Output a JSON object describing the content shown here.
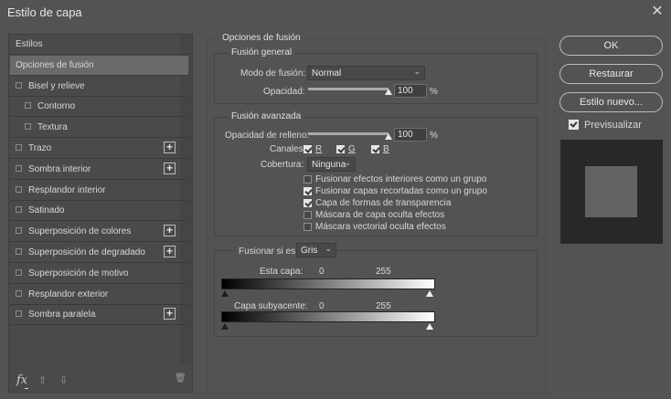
{
  "window": {
    "title": "Estilo de capa",
    "close_glyph": "✕"
  },
  "sidebar": {
    "items": [
      {
        "label": "Estilos",
        "checkbox": false,
        "plus": false,
        "indent": 0,
        "selected": false
      },
      {
        "label": "Opciones de fusión",
        "checkbox": false,
        "plus": false,
        "indent": 0,
        "selected": true
      },
      {
        "label": "Bisel y relieve",
        "checkbox": true,
        "plus": false,
        "indent": 0,
        "selected": false
      },
      {
        "label": "Contorno",
        "checkbox": true,
        "plus": false,
        "indent": 1,
        "selected": false
      },
      {
        "label": "Textura",
        "checkbox": true,
        "plus": false,
        "indent": 1,
        "selected": false
      },
      {
        "label": "Trazo",
        "checkbox": true,
        "plus": true,
        "indent": 0,
        "selected": false
      },
      {
        "label": "Sombra interior",
        "checkbox": true,
        "plus": true,
        "indent": 0,
        "selected": false
      },
      {
        "label": "Resplandor interior",
        "checkbox": true,
        "plus": false,
        "indent": 0,
        "selected": false
      },
      {
        "label": "Satinado",
        "checkbox": true,
        "plus": false,
        "indent": 0,
        "selected": false
      },
      {
        "label": "Superposición de colores",
        "checkbox": true,
        "plus": true,
        "indent": 0,
        "selected": false
      },
      {
        "label": "Superposición de degradado",
        "checkbox": true,
        "plus": true,
        "indent": 0,
        "selected": false
      },
      {
        "label": "Superposición de motivo",
        "checkbox": true,
        "plus": false,
        "indent": 0,
        "selected": false
      },
      {
        "label": "Resplandor exterior",
        "checkbox": true,
        "plus": false,
        "indent": 0,
        "selected": false
      },
      {
        "label": "Sombra paralela",
        "checkbox": true,
        "plus": true,
        "indent": 0,
        "selected": false
      }
    ],
    "bottom": {
      "fx": "fx",
      "up": "⇧",
      "down": "⇩",
      "trash": "🗑"
    }
  },
  "blending": {
    "section_title": "Opciones de fusión",
    "general": {
      "title": "Fusión general",
      "mode_label": "Modo de fusión:",
      "mode_value": "Normal",
      "opacity_label": "Opacidad:",
      "opacity_value": "100",
      "opacity_level": 1.0,
      "percent": "%"
    },
    "advanced": {
      "title": "Fusión avanzada",
      "fill_label": "Opacidad de relleno:",
      "fill_value": "100",
      "fill_level": 1.0,
      "percent": "%",
      "channels_label": "Canales:",
      "channels": [
        {
          "label": "R",
          "checked": true
        },
        {
          "label": "G",
          "checked": true
        },
        {
          "label": "B",
          "checked": true
        }
      ],
      "knockout_label": "Cobertura:",
      "knockout_value": "Ninguna",
      "options": [
        {
          "label": "Fusionar efectos interiores como un grupo",
          "checked": false
        },
        {
          "label": "Fusionar capas recortadas como un grupo",
          "checked": true
        },
        {
          "label": "Capa de formas de transparencia",
          "checked": true
        },
        {
          "label": "Máscara de capa oculta efectos",
          "checked": false
        },
        {
          "label": "Máscara vectorial oculta efectos",
          "checked": false
        }
      ]
    },
    "blend_if": {
      "label": "Fusionar si es:",
      "value": "Gris",
      "this_layer_label": "Esta capa:",
      "this_layer_low": "0",
      "this_layer_high": "255",
      "underlying_label": "Capa subyacente:",
      "underlying_low": "0",
      "underlying_high": "255"
    }
  },
  "buttons": {
    "ok": "OK",
    "reset": "Restaurar",
    "new_style": "Estilo nuevo...",
    "preview_label": "Previsualizar",
    "preview_checked": true
  }
}
